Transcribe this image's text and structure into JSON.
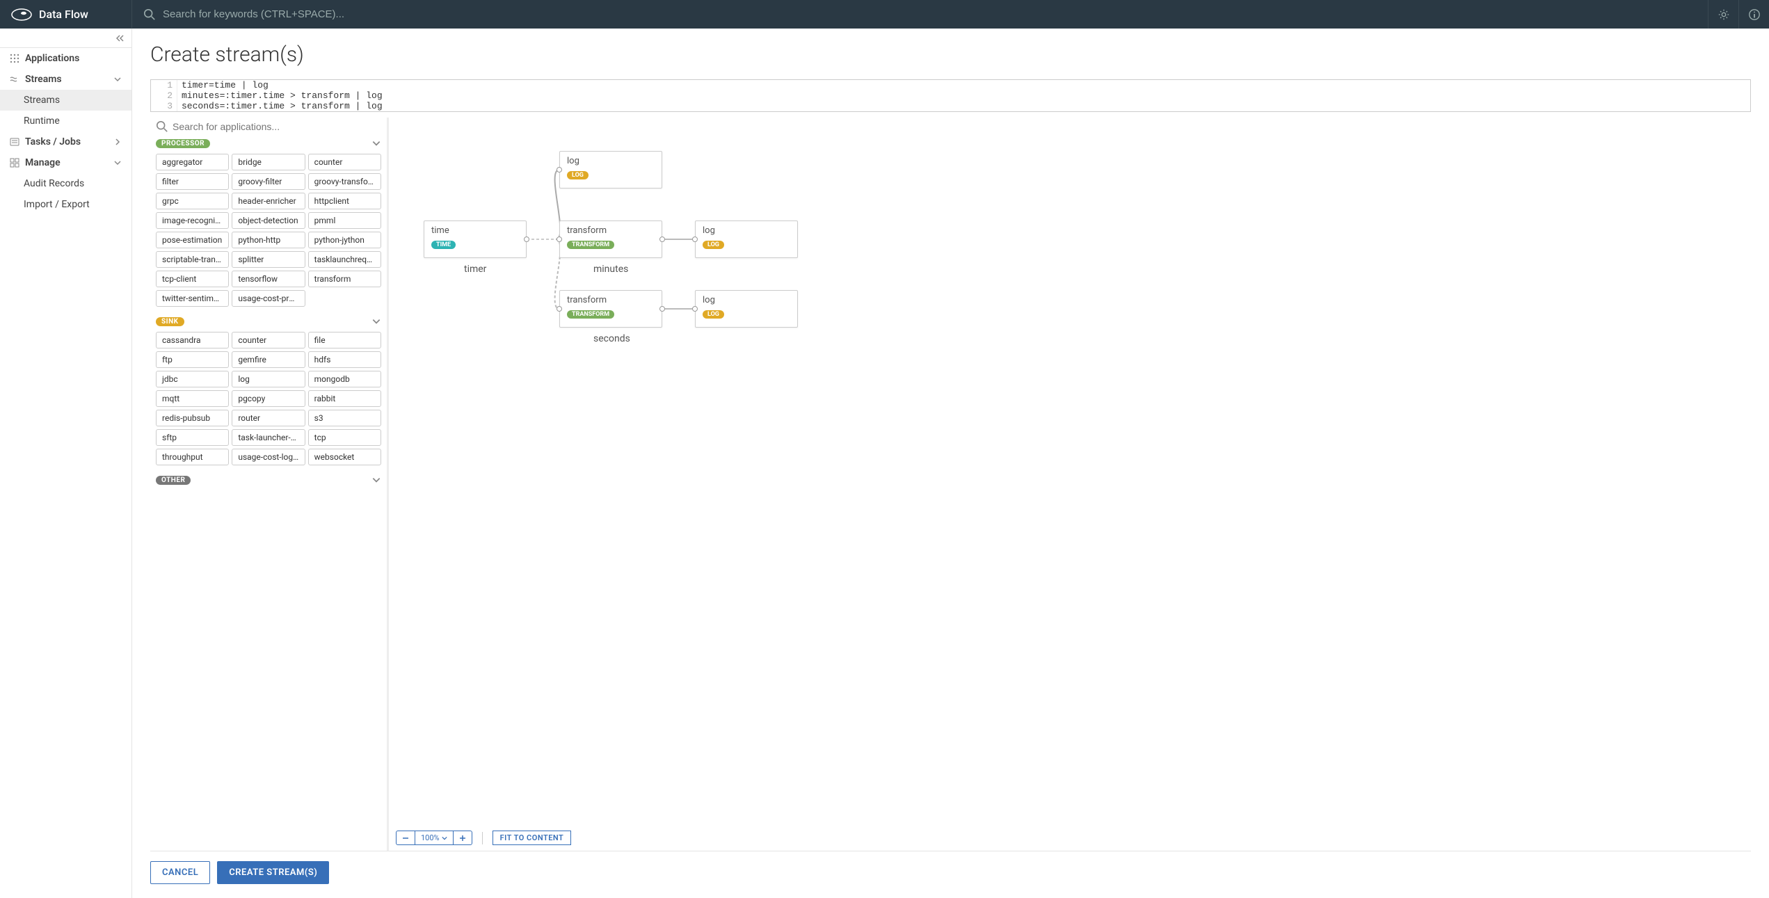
{
  "header": {
    "app_name": "Data Flow",
    "search_placeholder": "Search for keywords (CTRL+SPACE)..."
  },
  "sidebar": {
    "applications": "Applications",
    "streams": "Streams",
    "streams_sub": "Streams",
    "runtime": "Runtime",
    "tasks_jobs": "Tasks / Jobs",
    "manage": "Manage",
    "audit_records": "Audit Records",
    "import_export": "Import / Export"
  },
  "page": {
    "title": "Create stream(s)"
  },
  "editor": {
    "lines": [
      "timer=time | log",
      "minutes=:timer.time > transform | log",
      "seconds=:timer.time > transform | log"
    ]
  },
  "app_search_placeholder": "Search for applications...",
  "categories": {
    "processor": {
      "label": "PROCESSOR",
      "items": [
        "aggregator",
        "bridge",
        "counter",
        "filter",
        "groovy-filter",
        "groovy-transform",
        "grpc",
        "header-enricher",
        "httpclient",
        "image-recognition",
        "object-detection",
        "pmml",
        "pose-estimation",
        "python-http",
        "python-jython",
        "scriptable-transform",
        "splitter",
        "tasklaunchrequest",
        "tcp-client",
        "tensorflow",
        "transform",
        "twitter-sentiment",
        "usage-cost-processor"
      ]
    },
    "sink": {
      "label": "SINK",
      "items": [
        "cassandra",
        "counter",
        "file",
        "ftp",
        "gemfire",
        "hdfs",
        "jdbc",
        "log",
        "mongodb",
        "mqtt",
        "pgcopy",
        "rabbit",
        "redis-pubsub",
        "router",
        "s3",
        "sftp",
        "task-launcher-dataflow",
        "tcp",
        "throughput",
        "usage-cost-logger",
        "websocket"
      ]
    },
    "other": {
      "label": "OTHER"
    }
  },
  "canvas": {
    "nodes": {
      "timer": {
        "title": "time",
        "tag": "TIME"
      },
      "log_top": {
        "title": "log",
        "tag": "LOG"
      },
      "xf_min": {
        "title": "transform",
        "tag": "TRANSFORM"
      },
      "log_min": {
        "title": "log",
        "tag": "LOG"
      },
      "xf_sec": {
        "title": "transform",
        "tag": "TRANSFORM"
      },
      "log_sec": {
        "title": "log",
        "tag": "LOG"
      }
    },
    "labels": {
      "timer": "timer",
      "minutes": "minutes",
      "seconds": "seconds"
    },
    "zoom": "100%",
    "fit": "FIT TO CONTENT"
  },
  "footer": {
    "cancel": "CANCEL",
    "create": "CREATE STREAM(S)"
  }
}
